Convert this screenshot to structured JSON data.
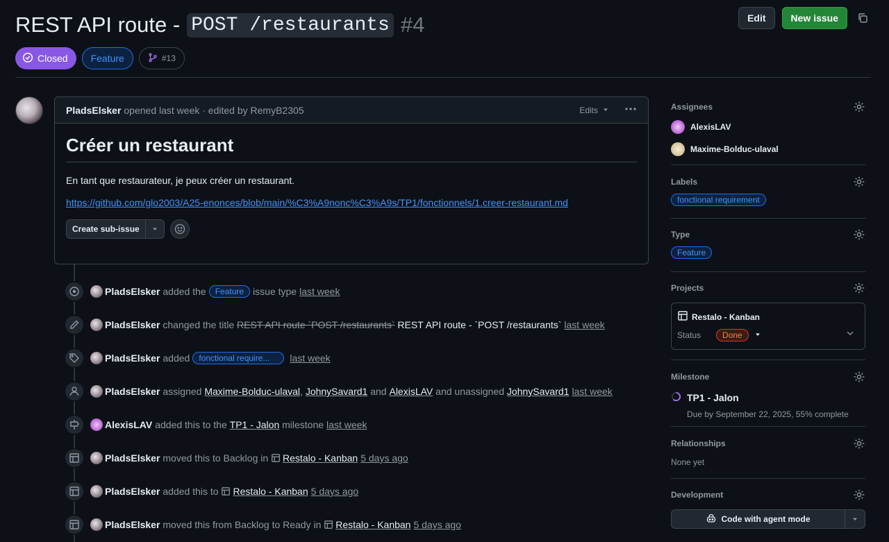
{
  "issue": {
    "title": "REST API route - ",
    "title_code": "POST /restaurants",
    "number": "#4",
    "state": "Closed",
    "type": "Feature",
    "linked_pr": "#13"
  },
  "header": {
    "edit_label": "Edit",
    "new_issue_label": "New issue"
  },
  "comment": {
    "author": "PladsElsker",
    "meta": "opened last week · edited by RemyB2305",
    "edits_label": "Edits",
    "heading": "Créer un restaurant",
    "paragraph": "En tant que restaurateur, je peux créer un restaurant.",
    "link": "https://github.com/glo2003/A25-enonces/blob/main/%C3%A9nonc%C3%A9s/TP1/fonctionnels/1.creer-restaurant.md",
    "sub_issue_label": "Create sub-issue"
  },
  "timeline": [
    {
      "icon": "issue-type-icon",
      "who": "PladsElsker",
      "parts": [
        "added the",
        "Feature",
        "issue type"
      ],
      "time": "last week"
    },
    {
      "icon": "pencil-icon",
      "who": "PladsElsker",
      "text1": "changed the title",
      "old": "REST API route `POST /restaurants`",
      "new": "REST API route - `POST /restaurants`",
      "time": "last week"
    },
    {
      "icon": "tag-icon",
      "who": "PladsElsker",
      "text1": "added",
      "label": "fonctional require...",
      "time": "last week"
    },
    {
      "icon": "person-icon",
      "who": "PladsElsker",
      "text1": "assigned",
      "u1": "Maxime-Bolduc-ulaval",
      "u2": "JohnySavard1",
      "and": "and",
      "u3": "AlexisLAV",
      "text2": "and unassigned",
      "u4": "JohnySavard1",
      "time": "last week"
    },
    {
      "icon": "milestone-icon",
      "who": "AlexisLAV",
      "text1": "added this to the",
      "milestone": "TP1 - Jalon",
      "text2": "milestone",
      "time": "last week"
    },
    {
      "icon": "table-icon",
      "who": "PladsElsker",
      "text1": "moved this to Backlog in",
      "project": "Restalo - Kanban",
      "time": "5 days ago"
    },
    {
      "icon": "table-icon",
      "who": "PladsElsker",
      "text1": "added this to",
      "project": "Restalo - Kanban",
      "time": "5 days ago"
    },
    {
      "icon": "table-icon",
      "who": "PladsElsker",
      "text1": "moved this from Backlog to Ready in",
      "project": "Restalo - Kanban",
      "time": "5 days ago"
    }
  ],
  "sidebar": {
    "assignees_title": "Assignees",
    "assignees": [
      "AlexisLAV",
      "Maxime-Bolduc-ulaval"
    ],
    "labels_title": "Labels",
    "label": "fonctional requirement",
    "type_title": "Type",
    "type": "Feature",
    "projects_title": "Projects",
    "project_name": "Restalo - Kanban",
    "status_label": "Status",
    "status_value": "Done",
    "milestone_title": "Milestone",
    "milestone_name": "TP1 - Jalon",
    "milestone_due": "Due by September 22, 2025, 55% complete",
    "relationships_title": "Relationships",
    "relationships_value": "None yet",
    "development_title": "Development",
    "agent_label": "Code with agent mode"
  },
  "colors": {
    "closed": "#8957e5",
    "accent": "#4493f8",
    "green": "#238636",
    "done": "#f0883e"
  }
}
